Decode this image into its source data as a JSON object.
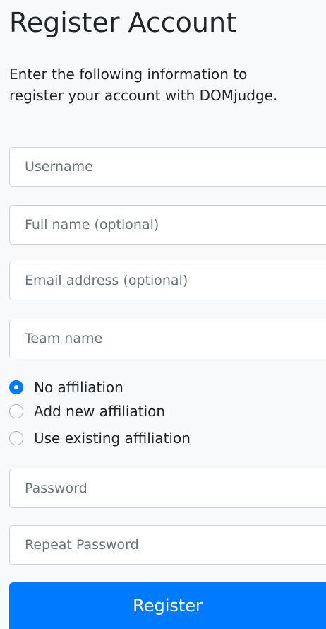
{
  "page": {
    "title": "Register Account",
    "intro": "Enter the following information to register your account with DOMjudge."
  },
  "fields": {
    "username": {
      "placeholder": "Username",
      "value": ""
    },
    "full_name": {
      "placeholder": "Full name (optional)",
      "value": ""
    },
    "email": {
      "placeholder": "Email address (optional)",
      "value": ""
    },
    "team_name": {
      "placeholder": "Team name",
      "value": ""
    },
    "password": {
      "placeholder": "Password",
      "value": ""
    },
    "repeat_password": {
      "placeholder": "Repeat Password",
      "value": ""
    }
  },
  "affiliation": {
    "selected": "No affiliation",
    "options": [
      "No affiliation",
      "Add new affiliation",
      "Use existing affiliation"
    ]
  },
  "actions": {
    "register_label": "Register"
  },
  "colors": {
    "background": "#f8f9fa",
    "primary": "#007bff",
    "border": "#ced4da",
    "placeholder": "#6c757d",
    "text": "#212529"
  }
}
